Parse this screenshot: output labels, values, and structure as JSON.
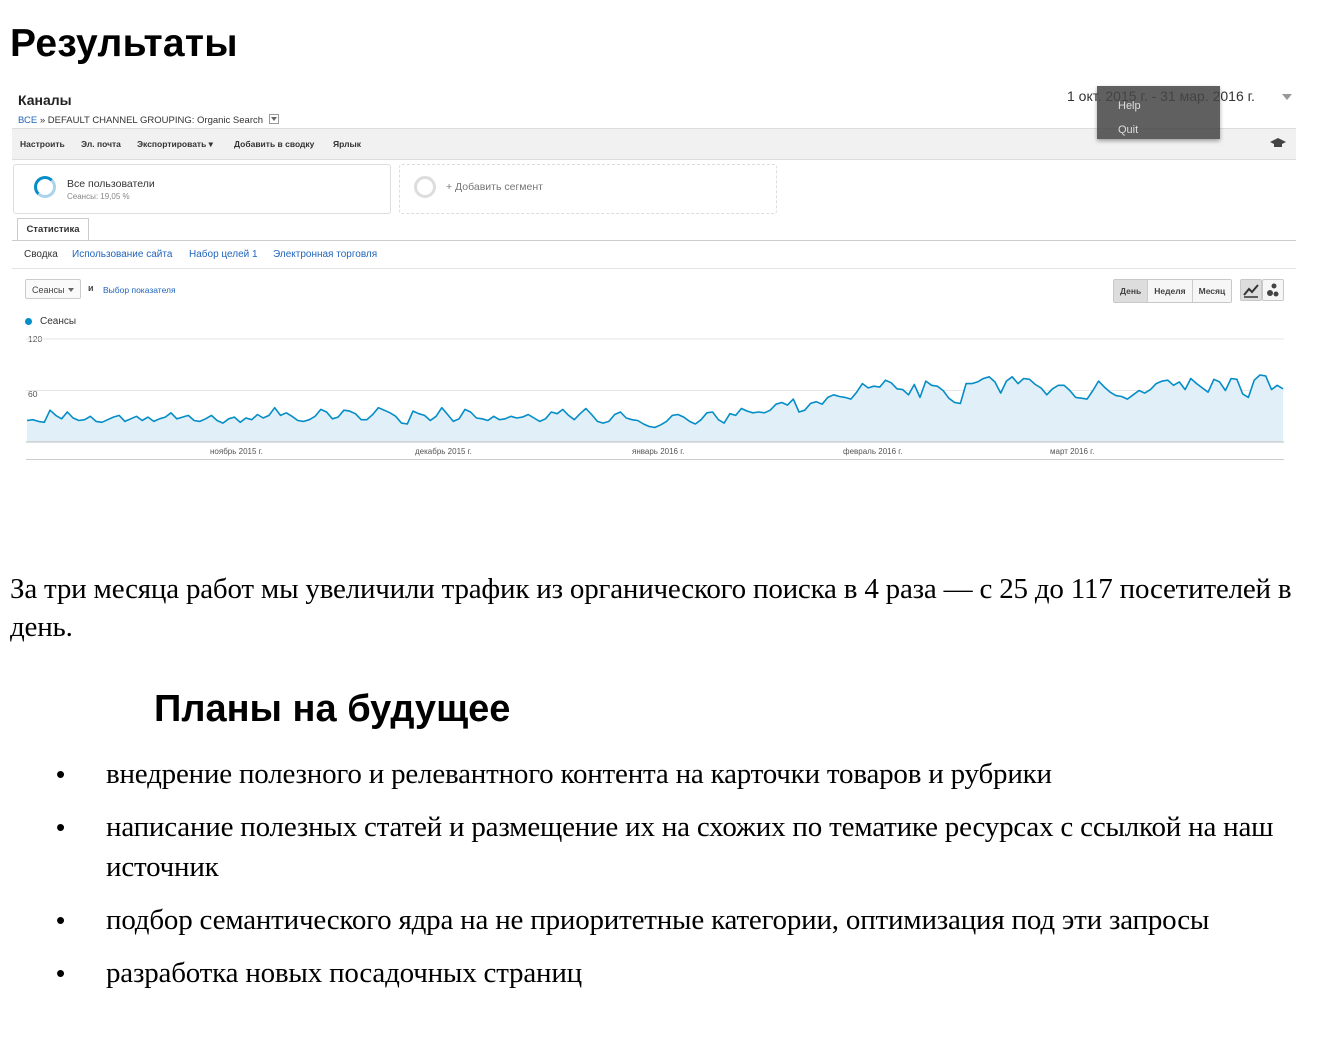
{
  "page_title": "Результаты",
  "ga": {
    "title": "Каналы",
    "breadcrumb": {
      "all": "ВСЕ",
      "sep": "»",
      "grouping": "DEFAULT CHANNEL GROUPING:",
      "value": "Organic Search"
    },
    "date_range": "1 окт. 2015 г. - 31 мар. 2016 г.",
    "context_menu": {
      "help": "Help",
      "quit": "Quit"
    },
    "toolbar": [
      "Настроить",
      "Эл. почта",
      "Экспортировать ▾",
      "Добавить в сводку",
      "Ярлык"
    ],
    "segment": {
      "name": "Все пользователи",
      "sub": "Сеансы: 19,05 %"
    },
    "add_segment": "+ Добавить сегмент",
    "tab": "Статистика",
    "subnav": [
      "Сводка",
      "Использование сайта",
      "Набор целей 1",
      "Электронная торговля"
    ],
    "metric": "Сеансы",
    "and": "и",
    "choose_metric": "Выбор показателя",
    "period_buttons": [
      "День",
      "Неделя",
      "Месяц"
    ],
    "legend": "Сеансы",
    "colors": {
      "line": "#058dc7",
      "fill": "#e1f0f8",
      "link": "#2266bb"
    }
  },
  "chart_data": {
    "type": "area",
    "series": [
      {
        "name": "Сеансы",
        "values": [
          25,
          26,
          24,
          23,
          37,
          31,
          27,
          35,
          28,
          25,
          26,
          30,
          24,
          23,
          26,
          29,
          31,
          24,
          27,
          30,
          25,
          29,
          24,
          27,
          29,
          34,
          27,
          29,
          31,
          25,
          24,
          27,
          31,
          25,
          22,
          27,
          29,
          23,
          28,
          26,
          32,
          28,
          31,
          40,
          31,
          34,
          30,
          25,
          24,
          26,
          30,
          38,
          35,
          27,
          29,
          37,
          36,
          33,
          26,
          26,
          32,
          40,
          37,
          34,
          30,
          22,
          21,
          36,
          33,
          31,
          25,
          30,
          40,
          32,
          24,
          27,
          38,
          35,
          28,
          27,
          25,
          30,
          26,
          27,
          30,
          28,
          29,
          32,
          28,
          24,
          27,
          35,
          33,
          38,
          31,
          26,
          33,
          39,
          32,
          24,
          22,
          24,
          32,
          35,
          28,
          26,
          25,
          21,
          18,
          17,
          20,
          24,
          31,
          32,
          29,
          24,
          21,
          26,
          34,
          35,
          26,
          22,
          33,
          31,
          39,
          36,
          34,
          35,
          34,
          37,
          44,
          46,
          43,
          50,
          35,
          37,
          45,
          47,
          44,
          52,
          55,
          53,
          52,
          50,
          58,
          68,
          63,
          65,
          64,
          72,
          69,
          62,
          61,
          55,
          67,
          52,
          71,
          66,
          65,
          60,
          51,
          46,
          45,
          68,
          68,
          70,
          74,
          76,
          70,
          57,
          71,
          76,
          68,
          74,
          73,
          67,
          63,
          55,
          62,
          66,
          66,
          60,
          52,
          51,
          50,
          60,
          71,
          64,
          58,
          54,
          53,
          50,
          55,
          60,
          57,
          61,
          68,
          71,
          72,
          66,
          70,
          61,
          74,
          68,
          63,
          58,
          73,
          70,
          60,
          74,
          73,
          56,
          52,
          72,
          78,
          77,
          61,
          66,
          62
        ],
        "note_x_range": "2015-10-01 to 2016-03-31, daily"
      }
    ],
    "x_tick_labels": [
      "ноябрь 2015 г.",
      "декабрь 2015 г.",
      "январь 2016 г.",
      "февраль 2016 г.",
      "март 2016 г."
    ],
    "y_tick_labels": [
      "120",
      "60"
    ],
    "ylim": [
      0,
      120
    ]
  },
  "paragraph": "За три месяца работ мы увеличили трафик из органического поиска в 4 раза — с 25 до 117 посетителей в день.",
  "plans_title": "Планы на будущее",
  "plans": [
    "внедрение полезного и релевантного контента на карточки товаров и рубрики",
    "написание полезных статей и размещение их на схожих по тематике ресурсах с ссылкой на наш источник",
    "подбор семантического ядра на не приоритетные категории, оптимизация под эти запросы",
    "разработка новых посадочных страниц"
  ]
}
